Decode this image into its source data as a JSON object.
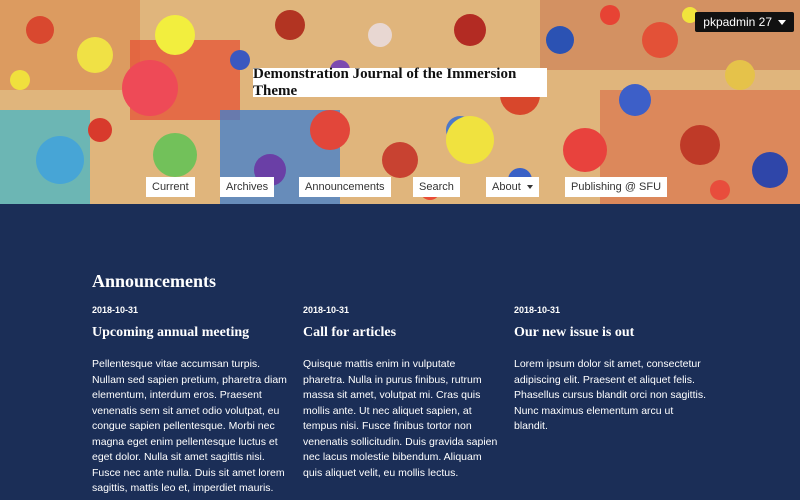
{
  "user_menu": {
    "label": "pkpadmin 27"
  },
  "site_title": "Demonstration Journal of the Immersion Theme",
  "nav": [
    {
      "label": "Current"
    },
    {
      "label": "Archives"
    },
    {
      "label": "Announcements"
    },
    {
      "label": "Search"
    },
    {
      "label": "About"
    },
    {
      "label": "Publishing @ SFU"
    }
  ],
  "announcements": {
    "title": "Announcements",
    "items": [
      {
        "date": "2018-10-31",
        "title": "Upcoming annual meeting",
        "body": "Pellentesque vitae accumsan turpis. Nullam sed sapien pretium, pharetra diam elementum, interdum eros. Praesent venenatis sem sit amet odio volutpat, eu congue sapien pellentesque. Morbi nec magna eget enim pellentesque luctus et eget dolor. Nulla sit amet sagittis nisi. Fusce nec ante nulla. Duis sit amet lorem sagittis, mattis leo et, imperdiet mauris."
      },
      {
        "date": "2018-10-31",
        "title": "Call for articles",
        "body": "Quisque mattis enim in vulputate pharetra. Nulla in purus finibus, rutrum massa sit amet, volutpat mi. Cras quis mollis ante. Ut nec aliquet sapien, at tempus nisi. Fusce finibus tortor non venenatis sollicitudin. Duis gravida sapien nec lacus molestie bibendum. Aliquam quis aliquet velit, eu mollis lectus."
      },
      {
        "date": "2018-10-31",
        "title": "Our new issue is out",
        "body": "Lorem ipsum dolor sit amet, consectetur adipiscing elit. Praesent et aliquet felis. Phasellus cursus blandit orci non sagittis. Nunc maximus elementum arcu ut blandit."
      }
    ]
  }
}
